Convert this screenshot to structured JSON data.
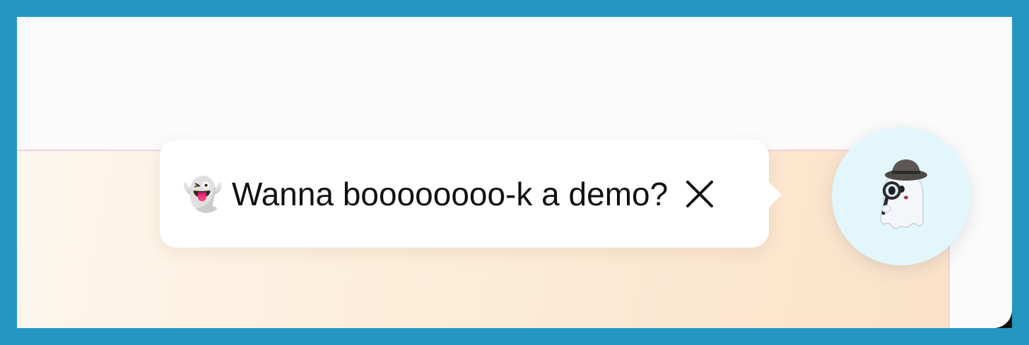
{
  "widget": {
    "greeting_emoji": "👻",
    "message": "Wanna boooooooo-k a demo?",
    "close_icon": "close-icon",
    "avatar_icon": "detective-ghost-icon"
  },
  "colors": {
    "frame": "#2596c1",
    "screen": "#fbfbfb",
    "bubble": "#ffffff",
    "avatar_bg": "#e3f6fc",
    "panel_gradient_start": "#fdf7ee",
    "panel_gradient_end": "#fbe2c8",
    "panel_border": "#f7cde4"
  }
}
